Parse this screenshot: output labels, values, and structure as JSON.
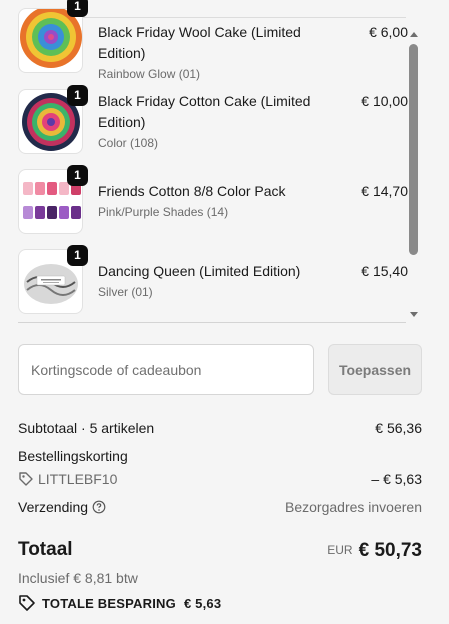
{
  "items": [
    {
      "title": "Black Friday Wool Cake (Limited Edition)",
      "variant": "Rainbow Glow (01)",
      "price": "€ 6,00",
      "quantity": "1",
      "thumb_icon": "rainbow-yarn-cake"
    },
    {
      "title": "Black Friday Cotton Cake (Limited Edition)",
      "variant": "Color (108)",
      "price": "€ 10,00",
      "quantity": "1",
      "thumb_icon": "cotton-yarn-cake"
    },
    {
      "title": "Friends Cotton 8/8 Color Pack",
      "variant": "Pink/Purple Shades (14)",
      "price": "€ 14,70",
      "quantity": "1",
      "thumb_icon": "yarn-color-pack"
    },
    {
      "title": "Dancing Queen (Limited Edition)",
      "variant": "Silver (01)",
      "price": "€ 15,40",
      "quantity": "1",
      "thumb_icon": "silver-yarn-ball"
    }
  ],
  "discount": {
    "placeholder": "Kortingscode of cadeaubon",
    "value": "",
    "apply_label": "Toepassen"
  },
  "summary": {
    "subtotal_label": "Subtotaal · 5 artikelen",
    "subtotal_value": "€ 56,36",
    "order_discount_label": "Bestellingskorting",
    "discount_code": "LITTLEBF10",
    "discount_value": "– € 5,63",
    "shipping_label": "Verzending",
    "shipping_value": "Bezorgadres invoeren"
  },
  "total": {
    "label": "Totaal",
    "currency": "EUR",
    "amount": "€ 50,73",
    "tax_note": "Inclusief € 8,81 btw",
    "savings_label": "TOTALE BESPARING",
    "savings_amount": "€ 5,63"
  },
  "colors": {
    "accent": "#0c0c0c",
    "muted_text": "#6b6b6b",
    "background": "#f5f5f5"
  }
}
